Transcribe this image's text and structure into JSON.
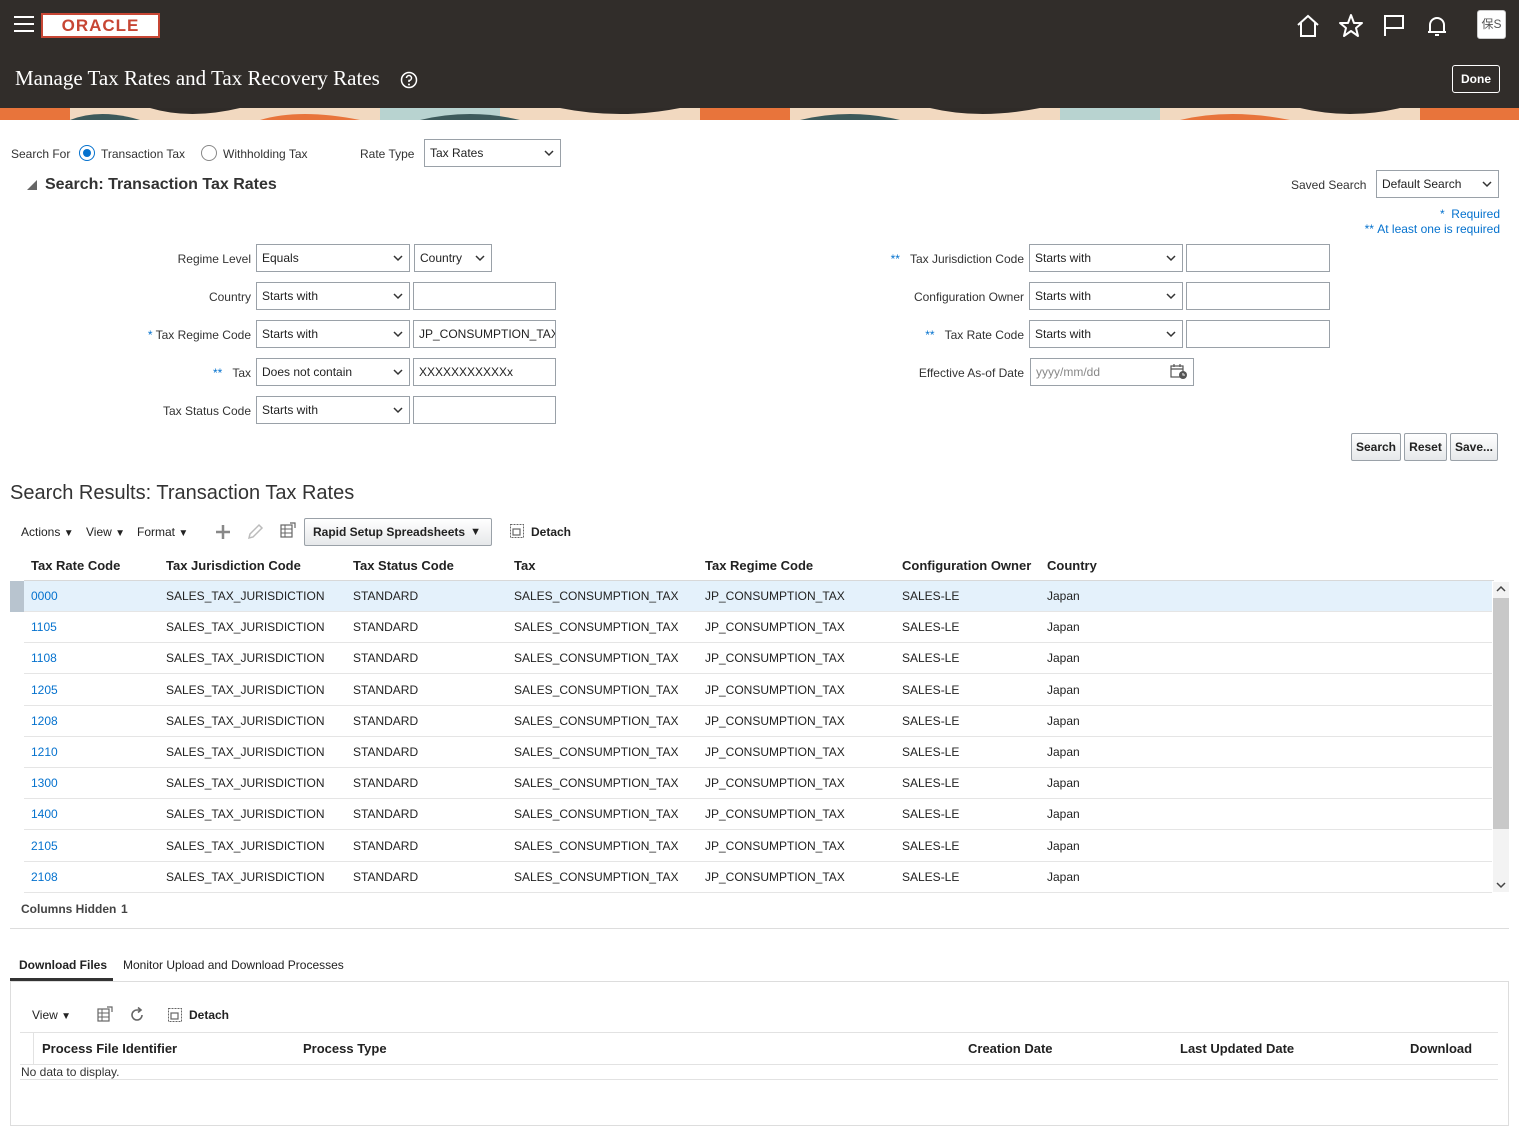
{
  "header": {
    "logo": "ORACLE",
    "page_title": "Manage Tax Rates and Tax Recovery Rates",
    "done_label": "Done",
    "avatar_text": "保S",
    "icons": [
      "home-icon",
      "star-icon",
      "flag-icon",
      "bell-icon"
    ]
  },
  "search_for": {
    "label": "Search For",
    "options": [
      "Transaction Tax",
      "Withholding Tax"
    ],
    "selected": "Transaction Tax",
    "rate_type_label": "Rate Type",
    "rate_type_value": "Tax Rates"
  },
  "search_panel": {
    "title": "Search: Transaction Tax Rates",
    "saved_search_label": "Saved Search",
    "saved_search_value": "Default Search",
    "required_note": "Required",
    "at_least_one_note": "At least one is required",
    "fields_left": [
      {
        "label": "Regime Level",
        "marker": "",
        "operator": "Equals",
        "value": "Country",
        "value_is_select": true
      },
      {
        "label": "Country",
        "marker": "",
        "operator": "Starts with",
        "value": ""
      },
      {
        "label": "Tax Regime Code",
        "marker": "*",
        "operator": "Starts with",
        "value": "JP_CONSUMPTION_TAX"
      },
      {
        "label": "Tax",
        "marker": "**",
        "operator": "Does not contain",
        "value": "XXXXXXXXXXXx"
      },
      {
        "label": "Tax Status Code",
        "marker": "",
        "operator": "Starts with",
        "value": ""
      }
    ],
    "fields_right": [
      {
        "label": "Tax Jurisdiction Code",
        "marker": "**",
        "operator": "Starts with",
        "value": ""
      },
      {
        "label": "Configuration Owner",
        "marker": "",
        "operator": "Starts with",
        "value": ""
      },
      {
        "label": "Tax Rate Code",
        "marker": "**",
        "operator": "Starts with",
        "value": ""
      }
    ],
    "date_field": {
      "label": "Effective As-of Date",
      "placeholder": "yyyy/mm/dd"
    },
    "buttons": {
      "search": "Search",
      "reset": "Reset",
      "save": "Save..."
    }
  },
  "results": {
    "title": "Search Results: Transaction Tax Rates",
    "toolbar": {
      "actions": "Actions",
      "view": "View",
      "format": "Format",
      "rapid_setup": "Rapid Setup Spreadsheets",
      "detach": "Detach"
    },
    "columns": [
      "Tax Rate Code",
      "Tax Jurisdiction Code",
      "Tax Status Code",
      "Tax",
      "Tax Regime Code",
      "Configuration Owner",
      "Country"
    ],
    "rows": [
      [
        "0000",
        "SALES_TAX_JURISDICTION",
        "STANDARD",
        "SALES_CONSUMPTION_TAX",
        "JP_CONSUMPTION_TAX",
        "SALES-LE",
        "Japan"
      ],
      [
        "1105",
        "SALES_TAX_JURISDICTION",
        "STANDARD",
        "SALES_CONSUMPTION_TAX",
        "JP_CONSUMPTION_TAX",
        "SALES-LE",
        "Japan"
      ],
      [
        "1108",
        "SALES_TAX_JURISDICTION",
        "STANDARD",
        "SALES_CONSUMPTION_TAX",
        "JP_CONSUMPTION_TAX",
        "SALES-LE",
        "Japan"
      ],
      [
        "1205",
        "SALES_TAX_JURISDICTION",
        "STANDARD",
        "SALES_CONSUMPTION_TAX",
        "JP_CONSUMPTION_TAX",
        "SALES-LE",
        "Japan"
      ],
      [
        "1208",
        "SALES_TAX_JURISDICTION",
        "STANDARD",
        "SALES_CONSUMPTION_TAX",
        "JP_CONSUMPTION_TAX",
        "SALES-LE",
        "Japan"
      ],
      [
        "1210",
        "SALES_TAX_JURISDICTION",
        "STANDARD",
        "SALES_CONSUMPTION_TAX",
        "JP_CONSUMPTION_TAX",
        "SALES-LE",
        "Japan"
      ],
      [
        "1300",
        "SALES_TAX_JURISDICTION",
        "STANDARD",
        "SALES_CONSUMPTION_TAX",
        "JP_CONSUMPTION_TAX",
        "SALES-LE",
        "Japan"
      ],
      [
        "1400",
        "SALES_TAX_JURISDICTION",
        "STANDARD",
        "SALES_CONSUMPTION_TAX",
        "JP_CONSUMPTION_TAX",
        "SALES-LE",
        "Japan"
      ],
      [
        "2105",
        "SALES_TAX_JURISDICTION",
        "STANDARD",
        "SALES_CONSUMPTION_TAX",
        "JP_CONSUMPTION_TAX",
        "SALES-LE",
        "Japan"
      ],
      [
        "2108",
        "SALES_TAX_JURISDICTION",
        "STANDARD",
        "SALES_CONSUMPTION_TAX",
        "JP_CONSUMPTION_TAX",
        "SALES-LE",
        "Japan"
      ]
    ],
    "columns_hidden_label": "Columns Hidden",
    "columns_hidden_count": "1"
  },
  "bottom": {
    "tabs": [
      "Download Files",
      "Monitor Upload and Download Processes"
    ],
    "active_tab": "Download Files",
    "toolbar": {
      "view": "View",
      "detach": "Detach"
    },
    "columns": [
      "Process File Identifier",
      "Process Type",
      "Creation Date",
      "Last Updated Date",
      "Download"
    ],
    "empty_text": "No data to display."
  },
  "colors": {
    "header_bg": "#312d2a",
    "link": "#0572ce",
    "selected_row": "#e4f1fb",
    "oracle_red": "#c74634"
  }
}
